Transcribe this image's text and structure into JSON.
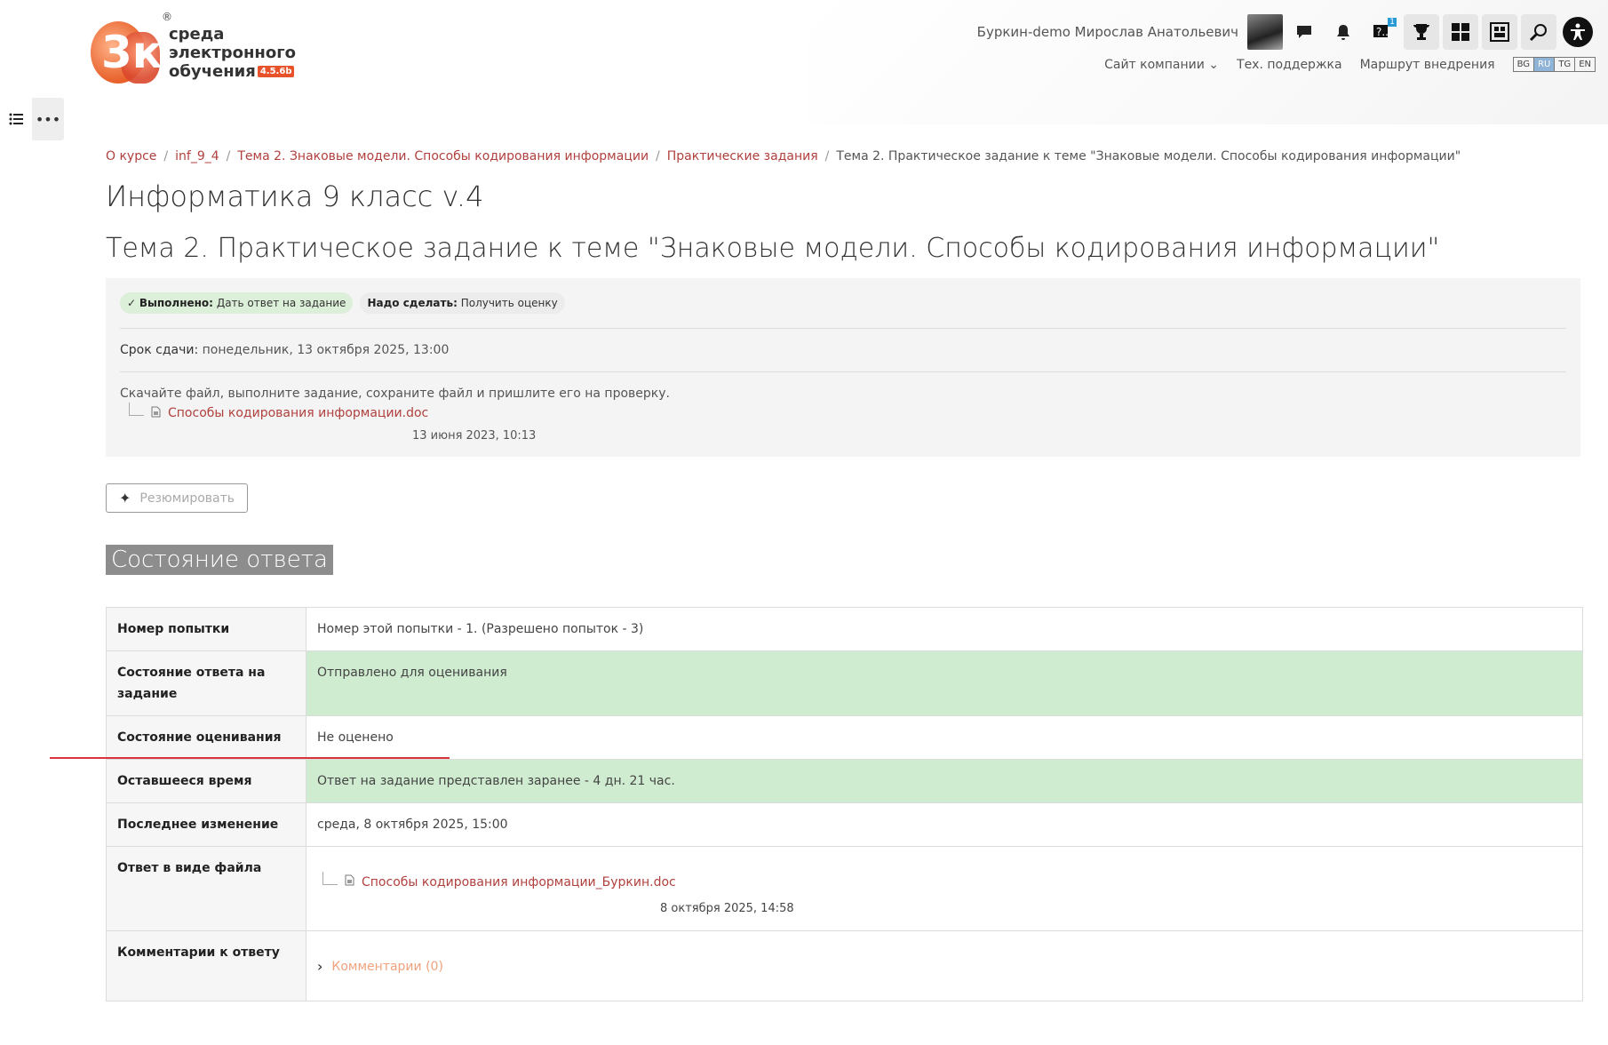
{
  "header": {
    "logo_lines": [
      "среда",
      "электронного",
      "обучения"
    ],
    "logo_version": "4.5.6b",
    "logo_reg": "®",
    "user_name": "Буркин-demo Мирослав Анатольевич",
    "help_badge": "1",
    "icons": [
      "chat-icon",
      "bell-icon",
      "help-icon",
      "trophy-icon",
      "dashboard-icon",
      "catalog-icon",
      "search-icon",
      "accessibility-icon"
    ],
    "nav": {
      "company_site": "Сайт компании",
      "support": "Тех. поддержка",
      "route": "Маршрут внедрения"
    },
    "languages": [
      "BG",
      "RU",
      "TG",
      "EN"
    ],
    "active_language": "RU"
  },
  "breadcrumb": {
    "items": [
      "О курсе",
      "inf_9_4",
      "Тема 2. Знаковые модели. Способы кодирования информации",
      "Практические задания",
      "Тема 2. Практическое задание к теме \"Знаковые модели. Способы кодирования информации\""
    ]
  },
  "course_title": "Информатика 9 класс v.4",
  "task_title": "Тема 2. Практическое задание к теме \"Знаковые модели. Способы кодирования информации\"",
  "completion": {
    "done_label": "Выполнено:",
    "done_text": "Дать ответ на задание",
    "todo_label": "Надо сделать:",
    "todo_text": "Получить оценку"
  },
  "due": {
    "label": "Срок сдачи:",
    "value": "понедельник, 13 октября 2025, 13:00"
  },
  "intro": {
    "text": "Скачайте файл, выполните задание, сохраните файл и пришлите его на проверку.",
    "file_name": "Способы кодирования информации.doc",
    "file_date": "13 июня 2023, 10:13"
  },
  "summarize_button": "Резюмировать",
  "status_heading": "Состояние ответа",
  "status_table": {
    "attempt_label": "Номер попытки",
    "attempt_value": "Номер этой попытки - 1. (Разрешено попыток - 3)",
    "submission_label": "Состояние ответа на задание",
    "submission_value": "Отправлено для оценивания",
    "grading_label": "Состояние оценивания",
    "grading_value": "Не оценено",
    "time_label": "Оставшееся время",
    "time_value": "Ответ на задание представлен заранее - 4 дн. 21 час.",
    "modified_label": "Последнее изменение",
    "modified_value": "среда, 8 октября 2025, 15:00",
    "file_label": "Ответ в виде файла",
    "file_name": "Способы кодирования информации_Буркин.doc",
    "file_date": "8 октября 2025, 14:58",
    "comments_label": "Комментарии к ответу",
    "comments_link": "Комментарии (0)"
  },
  "colors": {
    "link": "#b0413e",
    "success_bg": "#cfecd0",
    "heading_bg": "#8d8d8d",
    "annotation_line": "#d9343a"
  }
}
